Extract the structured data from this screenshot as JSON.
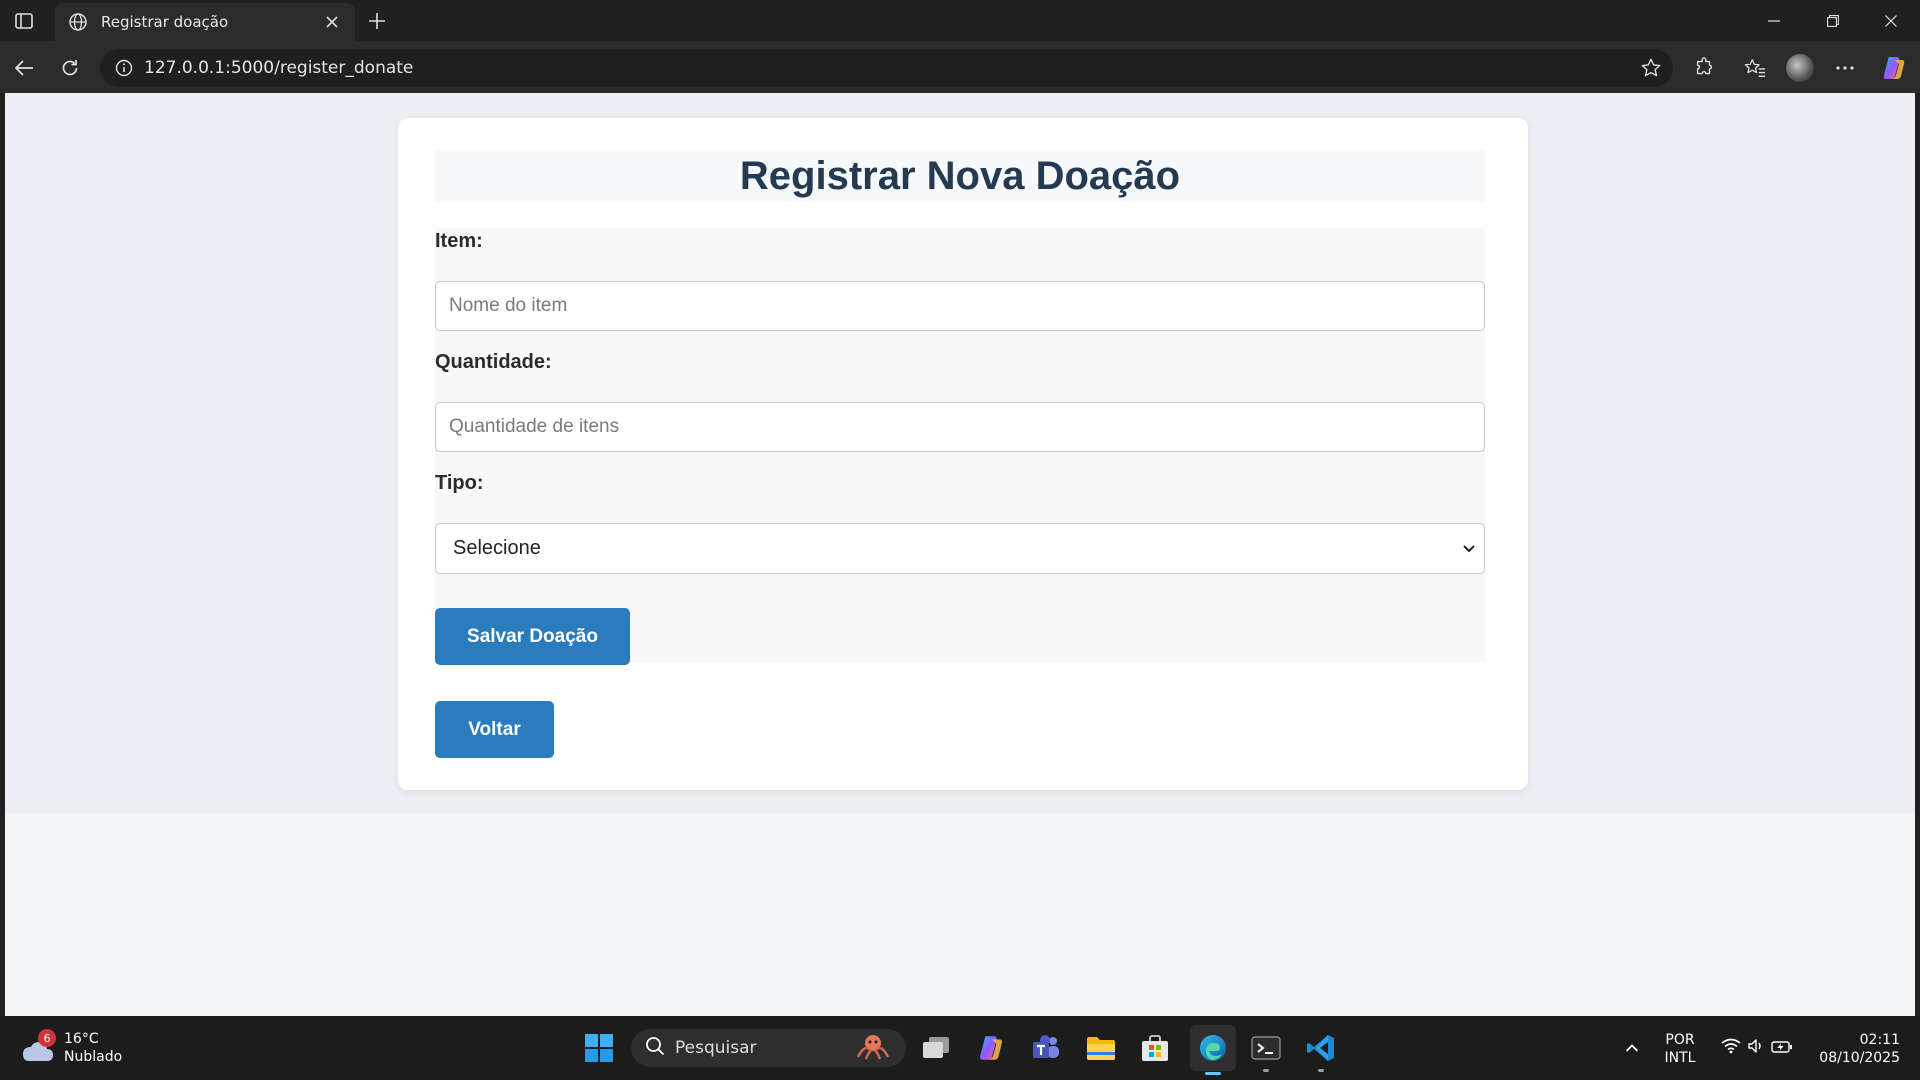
{
  "browser": {
    "tab_title": "Registrar doação",
    "url": "127.0.0.1:5000/register_donate"
  },
  "page": {
    "title": "Registrar Nova Doação",
    "item_label": "Item:",
    "item_placeholder": "Nome do item",
    "quantity_label": "Quantidade:",
    "quantity_placeholder": "Quantidade de itens",
    "type_label": "Tipo:",
    "type_selected": "Selecione",
    "save_button": "Salvar Doação",
    "back_button": "Voltar",
    "colors": {
      "title": "#243a52",
      "button": "#2b7bbf"
    }
  },
  "taskbar": {
    "weather_badge": "6",
    "weather_temp": "16°C",
    "weather_desc": "Nublado",
    "search_label": "Pesquisar",
    "lang_line1": "POR",
    "lang_line2": "INTL",
    "time": "02:11",
    "date": "08/10/2025"
  }
}
